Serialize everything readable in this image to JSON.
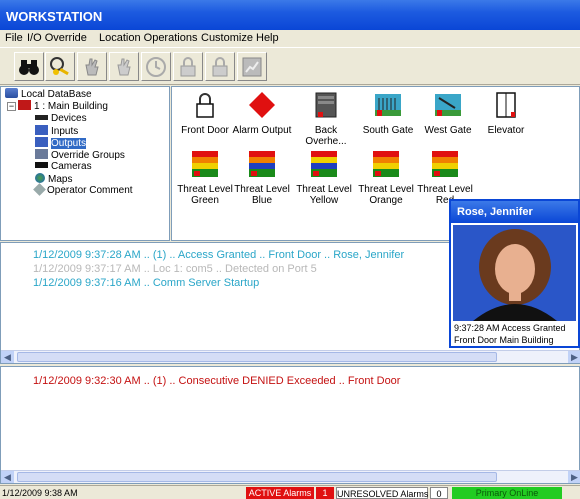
{
  "window": {
    "title": "WORKSTATION"
  },
  "menu": [
    "File",
    "I/O Override",
    "Location Operations",
    "Customize",
    "Help"
  ],
  "toolbar": {
    "icons": [
      "binoculars-icon",
      "key-search-icon",
      "alarm-hand-icon",
      "alarm-hand-disabled-icon",
      "clock-icon",
      "lock-icon",
      "lock-disabled-icon",
      "chart-icon"
    ]
  },
  "tree": {
    "root": "Local DataBase",
    "building": "1 : Main Building",
    "items": [
      "Devices",
      "Inputs",
      "Outputs",
      "Override Groups",
      "Cameras",
      "Maps",
      "Operator Comment"
    ],
    "selected": "Outputs"
  },
  "objects": {
    "row1": [
      {
        "label": "Front Door",
        "icon": "padlock-icon"
      },
      {
        "label": "Alarm Output",
        "icon": "red-diamond-icon"
      },
      {
        "label": "Back Overhe...",
        "icon": "overhead-door-icon"
      },
      {
        "label": "South Gate",
        "icon": "gate-icon"
      },
      {
        "label": "West Gate",
        "icon": "gate-icon"
      },
      {
        "label": "Elevator",
        "icon": "elevator-icon"
      }
    ],
    "row2": [
      {
        "label": "Threat Level Green",
        "icon": "threat-level-icon",
        "color": "#1a8a1a"
      },
      {
        "label": "Threat Level Blue",
        "icon": "threat-level-icon",
        "color": "#1f3fbf"
      },
      {
        "label": "Threat Level Yellow",
        "icon": "threat-level-icon",
        "color": "#f0d000"
      },
      {
        "label": "Threat Level Orange",
        "icon": "threat-level-icon",
        "color": "#f08000"
      },
      {
        "label": "Threat Level Red",
        "icon": "threat-level-icon",
        "color": "#d01010"
      }
    ]
  },
  "log_top": [
    {
      "text": "1/12/2009 9:37:28 AM .. (1) .. Access Granted .. Front Door .. Rose, Jennifer",
      "color": "#2aa6c8"
    },
    {
      "text": "1/12/2009 9:37:17 AM .. Loc 1: com5 .. Detected on Port 5",
      "color": "#b8b8b8"
    },
    {
      "text": "1/12/2009 9:37:16 AM .. Comm Server Startup",
      "color": "#2aa6c8"
    }
  ],
  "log_bottom": [
    {
      "text": "1/12/2009 9:32:30 AM .. (1) .. Consecutive DENIED Exceeded .. Front Door"
    }
  ],
  "popup": {
    "title": "Rose, Jennifer",
    "line1": "9:37:28 AM  Access Granted",
    "line2": "Front Door  Main Building"
  },
  "status": {
    "datetime": "1/12/2009 9:38 AM",
    "active_label": "ACTIVE Alarms",
    "active_count": "1",
    "unresolved_label": "UNRESOLVED Alarms",
    "unresolved_count": "0",
    "online": "Primary OnLine"
  },
  "colors": {
    "title_blue": "#0a46d6",
    "active_red": "#e01010",
    "online_green": "#22cc22"
  }
}
